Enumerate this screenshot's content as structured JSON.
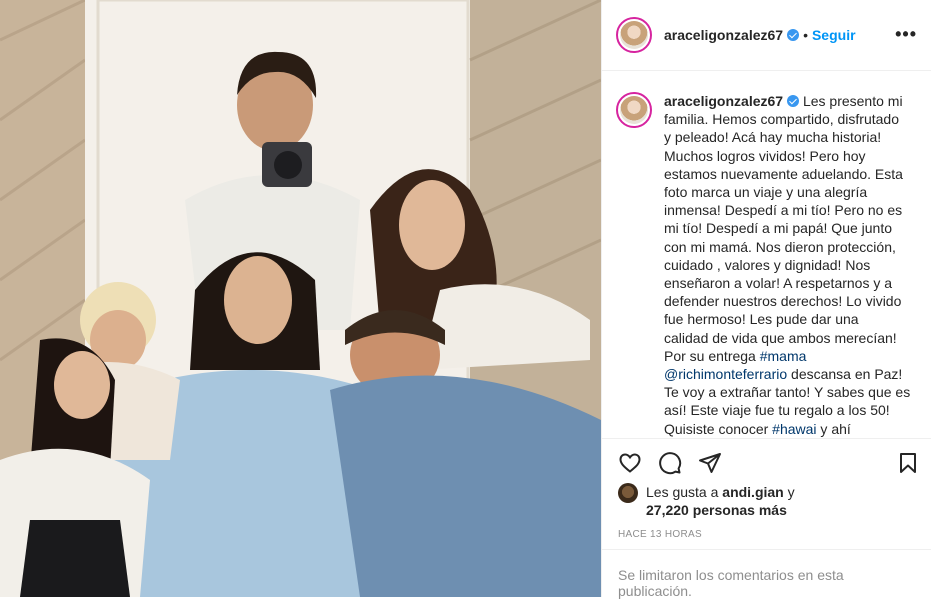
{
  "post": {
    "username": "araceligonzalez67",
    "separator": "•",
    "follow_label": "Seguir",
    "more_label": "•••",
    "caption_lines": [
      "Les presento mi",
      "familia. Hemos compartido, disfrutado",
      "y peleado! Acá hay mucha historia!",
      "Muchos logros vividos! Pero hoy",
      "estamos nuevamente aduelando. Esta",
      "foto marca un viaje y una alegría",
      "inmensa! Despedí a mi tío! Pero no es",
      "mi tío! Despedí a mi papá! Que junto",
      "con mi mamá. Nos dieron protección,",
      "cuidado , valores y dignidad! Nos",
      "enseñaron a volar! A respetarnos y a",
      "defender nuestros derechos! Lo vivido",
      "fue hermoso! Les pude dar una",
      "calidad de vida que ambos merecían!",
      "Por su entrega"
    ],
    "hashtag_mama": "#mama",
    "mention": "@richimonteferrario",
    "after_mention": " descansa en Paz!",
    "caption_tail_lines": [
      "Te voy a extrañar tanto! Y sabes que es",
      "así! Este viaje fue tu regalo a los 50!"
    ],
    "tail_before_tag": "Quisiste conocer ",
    "hashtag_hawai": "#hawai",
    "tail_after_tag": " y ahí",
    "likes_prefix": "Les gusta a ",
    "likes_user": "andi.gian",
    "likes_mid": " y",
    "likes_count": "27,220 personas más",
    "timestamp": "HACE 13 HORAS",
    "comments_limited": "Se limitaron los comentarios en esta publicación."
  },
  "colors": {
    "link": "#0095f6",
    "tag": "#00376b",
    "verified": "#3897f0"
  }
}
